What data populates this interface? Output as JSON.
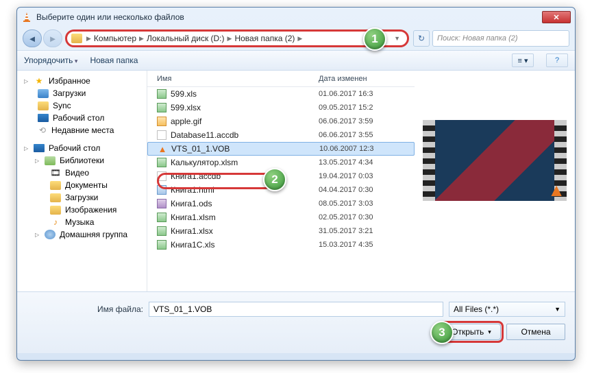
{
  "window": {
    "title": "Выберите один или несколько файлов"
  },
  "breadcrumb": {
    "items": [
      "Компьютер",
      "Локальный диск (D:)",
      "Новая папка (2)"
    ]
  },
  "search": {
    "placeholder": "Поиск: Новая папка (2)"
  },
  "toolbar": {
    "organize": "Упорядочить",
    "newfolder": "Новая папка"
  },
  "sidebar": {
    "fav_label": "Избранное",
    "fav_items": [
      "Загрузки",
      "Sync",
      "Рабочий стол",
      "Недавние места"
    ],
    "desk_label": "Рабочий стол",
    "lib_label": "Библиотеки",
    "lib_items": [
      "Видео",
      "Документы",
      "Загрузки",
      "Изображения",
      "Музыка"
    ],
    "homegroup": "Домашняя группа"
  },
  "columns": {
    "name": "Имя",
    "date": "Дата изменен"
  },
  "files": [
    {
      "name": "599.xls",
      "date": "01.06.2017 16:3",
      "type": "xls"
    },
    {
      "name": "599.xlsx",
      "date": "09.05.2017 15:2",
      "type": "xls"
    },
    {
      "name": "apple.gif",
      "date": "06.06.2017 3:59",
      "type": "gif"
    },
    {
      "name": "Database11.accdb",
      "date": "06.06.2017 3:55",
      "type": "accdb"
    },
    {
      "name": "VTS_01_1.VOB",
      "date": "10.06.2007 12:3",
      "type": "vob",
      "selected": true
    },
    {
      "name": "Калькулятор.xlsm",
      "date": "13.05.2017 4:34",
      "type": "xls"
    },
    {
      "name": "Книга1.accdb",
      "date": "19.04.2017 0:03",
      "type": "accdb"
    },
    {
      "name": "Книга1.html",
      "date": "04.04.2017 0:30",
      "type": "html"
    },
    {
      "name": "Книга1.ods",
      "date": "08.05.2017 3:03",
      "type": "ods"
    },
    {
      "name": "Книга1.xlsm",
      "date": "02.05.2017 0:30",
      "type": "xls"
    },
    {
      "name": "Книга1.xlsx",
      "date": "31.05.2017 3:21",
      "type": "xls"
    },
    {
      "name": "Книга1C.xls",
      "date": "15.03.2017 4:35",
      "type": "xls"
    }
  ],
  "footer": {
    "filename_label": "Имя файла:",
    "filename_value": "VTS_01_1.VOB",
    "filter": "All Files (*.*)",
    "open": "Открыть",
    "cancel": "Отмена"
  },
  "callouts": [
    "1",
    "2",
    "3"
  ]
}
